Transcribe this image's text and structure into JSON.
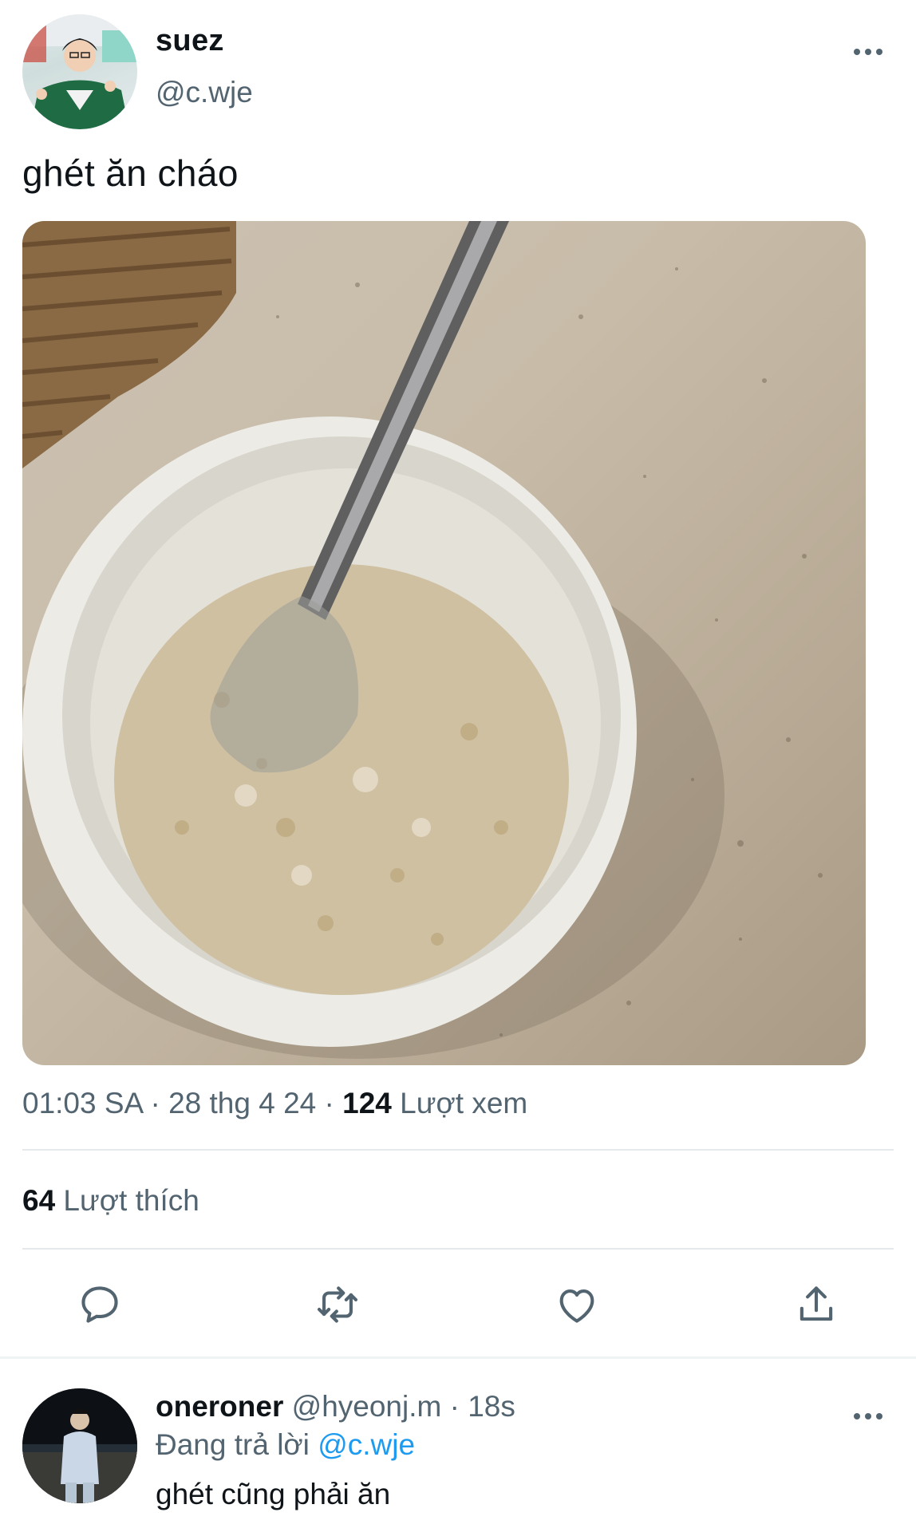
{
  "tweet": {
    "display_name": "suez",
    "handle": "@c.wje",
    "text": "ghét ăn cháo",
    "time": "01:03 SA",
    "sep1": " · ",
    "date": "28 thg 4 24",
    "sep2": " · ",
    "views_count": "124",
    "views_label": " Lượt xem",
    "likes_count": "64",
    "likes_label": " Lượt thích"
  },
  "reply": {
    "display_name": "oneroner",
    "handle": "@hyeonj.m",
    "separator": " · ",
    "time": "18s",
    "replying_prefix": "Đang trả lời ",
    "replying_to": "@c.wje",
    "text": "ghét cũng phải ăn"
  },
  "icons": {
    "more": "more-horizontal-icon",
    "reply": "reply-bubble-icon",
    "retweet": "retweet-icon",
    "like": "heart-icon",
    "share": "share-upload-icon"
  },
  "colors": {
    "text_primary": "#0f1419",
    "text_secondary": "#536471",
    "link": "#1d9bf0",
    "divider": "#e6e9eb"
  }
}
